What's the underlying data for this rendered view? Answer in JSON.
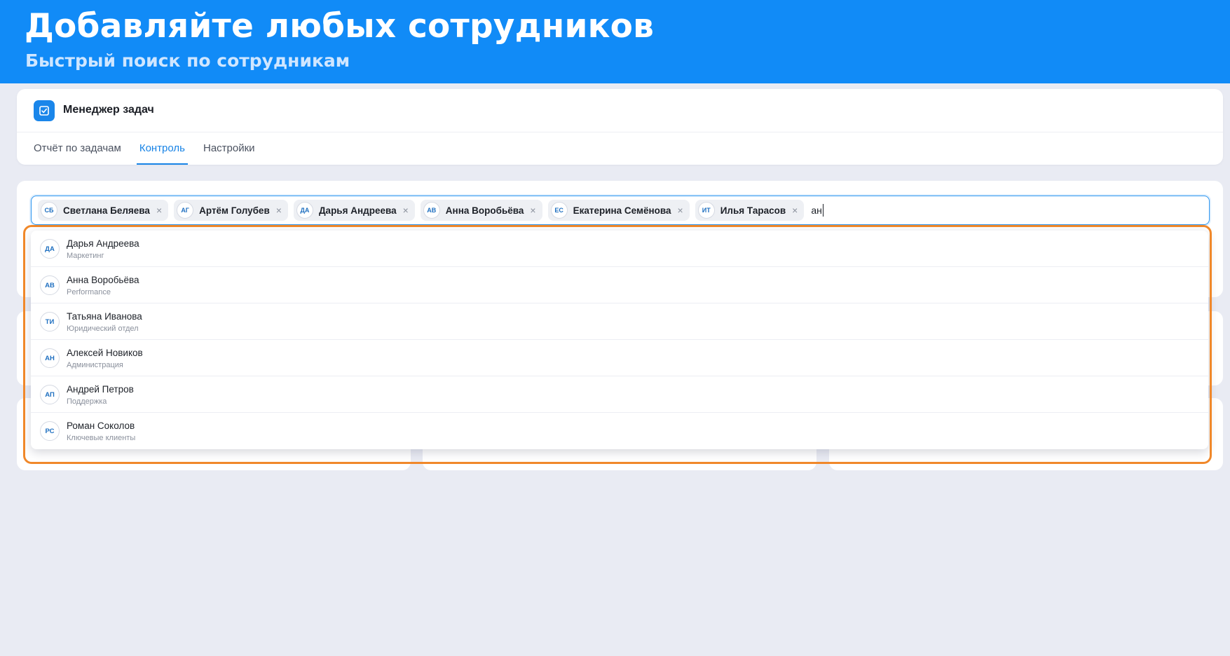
{
  "banner": {
    "title": "Добавляйте любых сотрудников",
    "subtitle": "Быстрый поиск по сотрудникам"
  },
  "app": {
    "title": "Менеджер задач",
    "logo_icon": "checkbox-edit-icon",
    "tabs": [
      {
        "label": "Отчёт по задачам",
        "active": false
      },
      {
        "label": "Контроль",
        "active": true
      },
      {
        "label": "Настройки",
        "active": false
      }
    ]
  },
  "picker": {
    "selected": [
      {
        "initials": "СБ",
        "name": "Светлана Беляева"
      },
      {
        "initials": "АГ",
        "name": "Артём Голубев"
      },
      {
        "initials": "ДА",
        "name": "Дарья Андреева"
      },
      {
        "initials": "АВ",
        "name": "Анна Воробьёва"
      },
      {
        "initials": "ЕС",
        "name": "Екатерина Семёнова"
      },
      {
        "initials": "ИТ",
        "name": "Илья Тарасов"
      }
    ],
    "remove_glyph": "×",
    "query": "ан",
    "options": [
      {
        "initials": "ДА",
        "name": "Дарья Андреева",
        "dept": "Маркетинг"
      },
      {
        "initials": "АВ",
        "name": "Анна Воробьёва",
        "dept": "Performance"
      },
      {
        "initials": "ТИ",
        "name": "Татьяна Иванова",
        "dept": "Юридический отдел"
      },
      {
        "initials": "АН",
        "name": "Алексей Новиков",
        "dept": "Администрация"
      },
      {
        "initials": "АП",
        "name": "Андрей Петров",
        "dept": "Поддержка"
      },
      {
        "initials": "РС",
        "name": "Роман Соколов",
        "dept": "Ключевые клиенты"
      }
    ]
  },
  "colors": {
    "accent": "#1783e6",
    "banner": "#118bf7",
    "highlight": "#f0882a"
  }
}
